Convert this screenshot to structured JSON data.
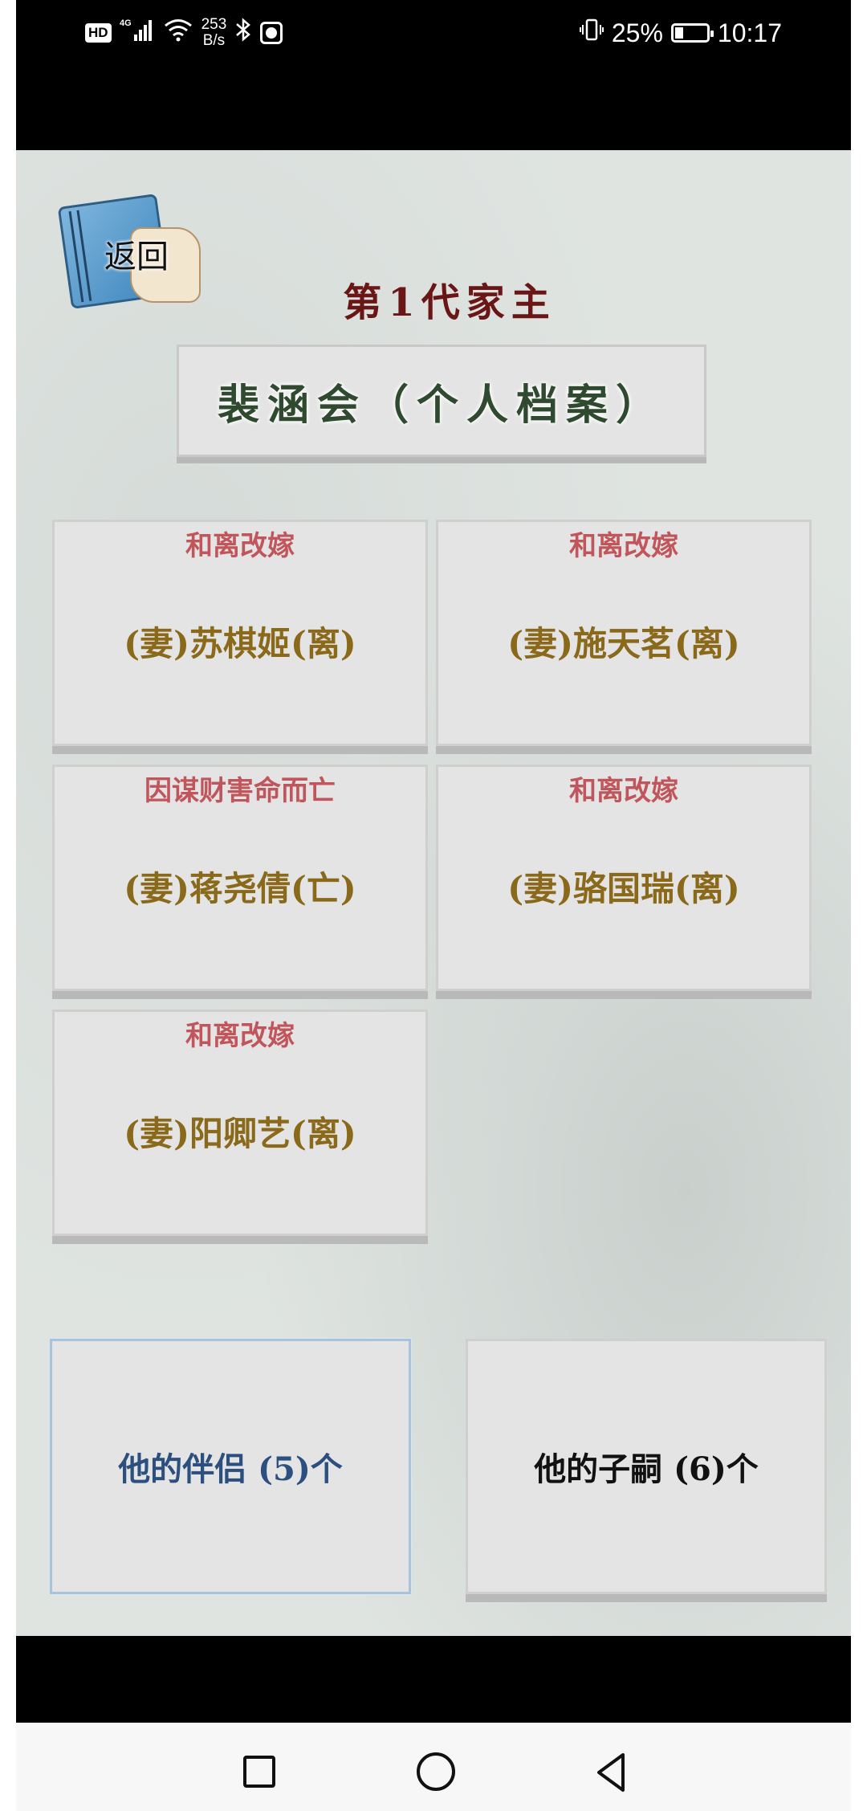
{
  "status_bar": {
    "hd": "HD",
    "network": "4G",
    "net_speed_value": "253",
    "net_speed_unit": "B/s",
    "battery": "25%",
    "battery_level": 0.25,
    "time": "10:17"
  },
  "header": {
    "back_label": "返回",
    "generation_title": "第1代家主",
    "person_title": "裴涵会（个人档案）"
  },
  "spouses": [
    {
      "reason": "和离改嫁",
      "label": "(妻)苏棋姬(离)"
    },
    {
      "reason": "和离改嫁",
      "label": "(妻)施天茗(离)"
    },
    {
      "reason": "因谋财害命而亡",
      "label": "(妻)蒋尧倩(亡)"
    },
    {
      "reason": "和离改嫁",
      "label": "(妻)骆国瑞(离)"
    },
    {
      "reason": "和离改嫁",
      "label": "(妻)阳卿艺(离)"
    }
  ],
  "tabs": {
    "partners": "他的伴侣 (5)个",
    "children": "他的子嗣 (6)个"
  },
  "colors": {
    "title": "#6b1616",
    "name": "#2f4a2f",
    "reason": "#c0565c",
    "spouse": "#8a6a1a",
    "active_tab": "#2b4f7e"
  }
}
